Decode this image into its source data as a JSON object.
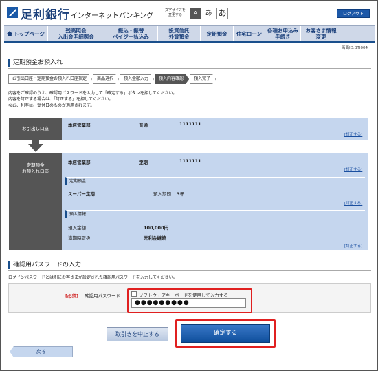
{
  "header": {
    "bank_name": "足利銀行",
    "service_name": "インターネットバンキング",
    "font_size_label": "文字サイズを\n変更する",
    "font_size_options": [
      "A",
      "あ",
      "あ"
    ],
    "logout_label": "ログアウト"
  },
  "nav": {
    "items": [
      {
        "label": "トップページ",
        "icon": "home-icon"
      },
      {
        "label": "残高照会\n入出金明細照会"
      },
      {
        "label": "振込・振替\nペイジー払込み"
      },
      {
        "label": "投資信託\n外貨預金"
      },
      {
        "label": "定期預金"
      },
      {
        "label": "住宅ローン"
      },
      {
        "label": "各種お申込み\n手続き"
      },
      {
        "label": "お客さま情報\n変更"
      }
    ]
  },
  "screen_id": "画面ID:BTI004",
  "page_title": "定期預金お預入れ",
  "steps": [
    {
      "label": "お引出口座・定期預金お預入れ口座指定",
      "active": false
    },
    {
      "label": "商品選択",
      "active": false
    },
    {
      "label": "預入金額入力",
      "active": false
    },
    {
      "label": "預入内容確認",
      "active": true
    },
    {
      "label": "預入完了",
      "active": false
    }
  ],
  "instructions": [
    "内容をご確認のうえ、確認用パスワードを入力して「確定する」ボタンを押してください。",
    "内容を訂正する場合は、「訂正する」を押してください。",
    "なお、利率は、受付日のものが適用されます。"
  ],
  "withdraw": {
    "label": "お引出し口座",
    "branch": "本店営業部",
    "type": "普通",
    "account": "1111111",
    "fix_link": "[訂正する]"
  },
  "deposit": {
    "label": "定期預金\nお預入れ口座",
    "branch": "本店営業部",
    "type": "定期",
    "account": "1111111",
    "fix_link": "[訂正する]",
    "product_section": {
      "title": "定期預金",
      "product_name": "スーパー定期",
      "period_label": "預入期間",
      "period_value": "3年",
      "fix_link": "[訂正する]"
    },
    "amount_section": {
      "title": "預入情報",
      "amount_label": "預入金額",
      "amount_value": "100,000円",
      "maturity_label": "満期時取扱",
      "maturity_value": "元利金継続",
      "fix_link": "[訂正する]"
    }
  },
  "password_section": {
    "title": "確認用パスワードの入力",
    "instruction": "ログインパスワードとは別にお客さまが設定された確認用パスワードを入力してください。",
    "required": "[必須]",
    "label": "確認用パスワード",
    "sw_keyboard_label": "ソフトウェアキーボードを使用して入力する",
    "value": "●●●●●●●●●"
  },
  "buttons": {
    "cancel": "取引きを中止する",
    "confirm": "確定する",
    "back": "戻る"
  },
  "colors": {
    "accent": "#1a4f8c",
    "panel": "#c5d6ee",
    "label_bg": "#555555",
    "highlight": "#e02020"
  }
}
